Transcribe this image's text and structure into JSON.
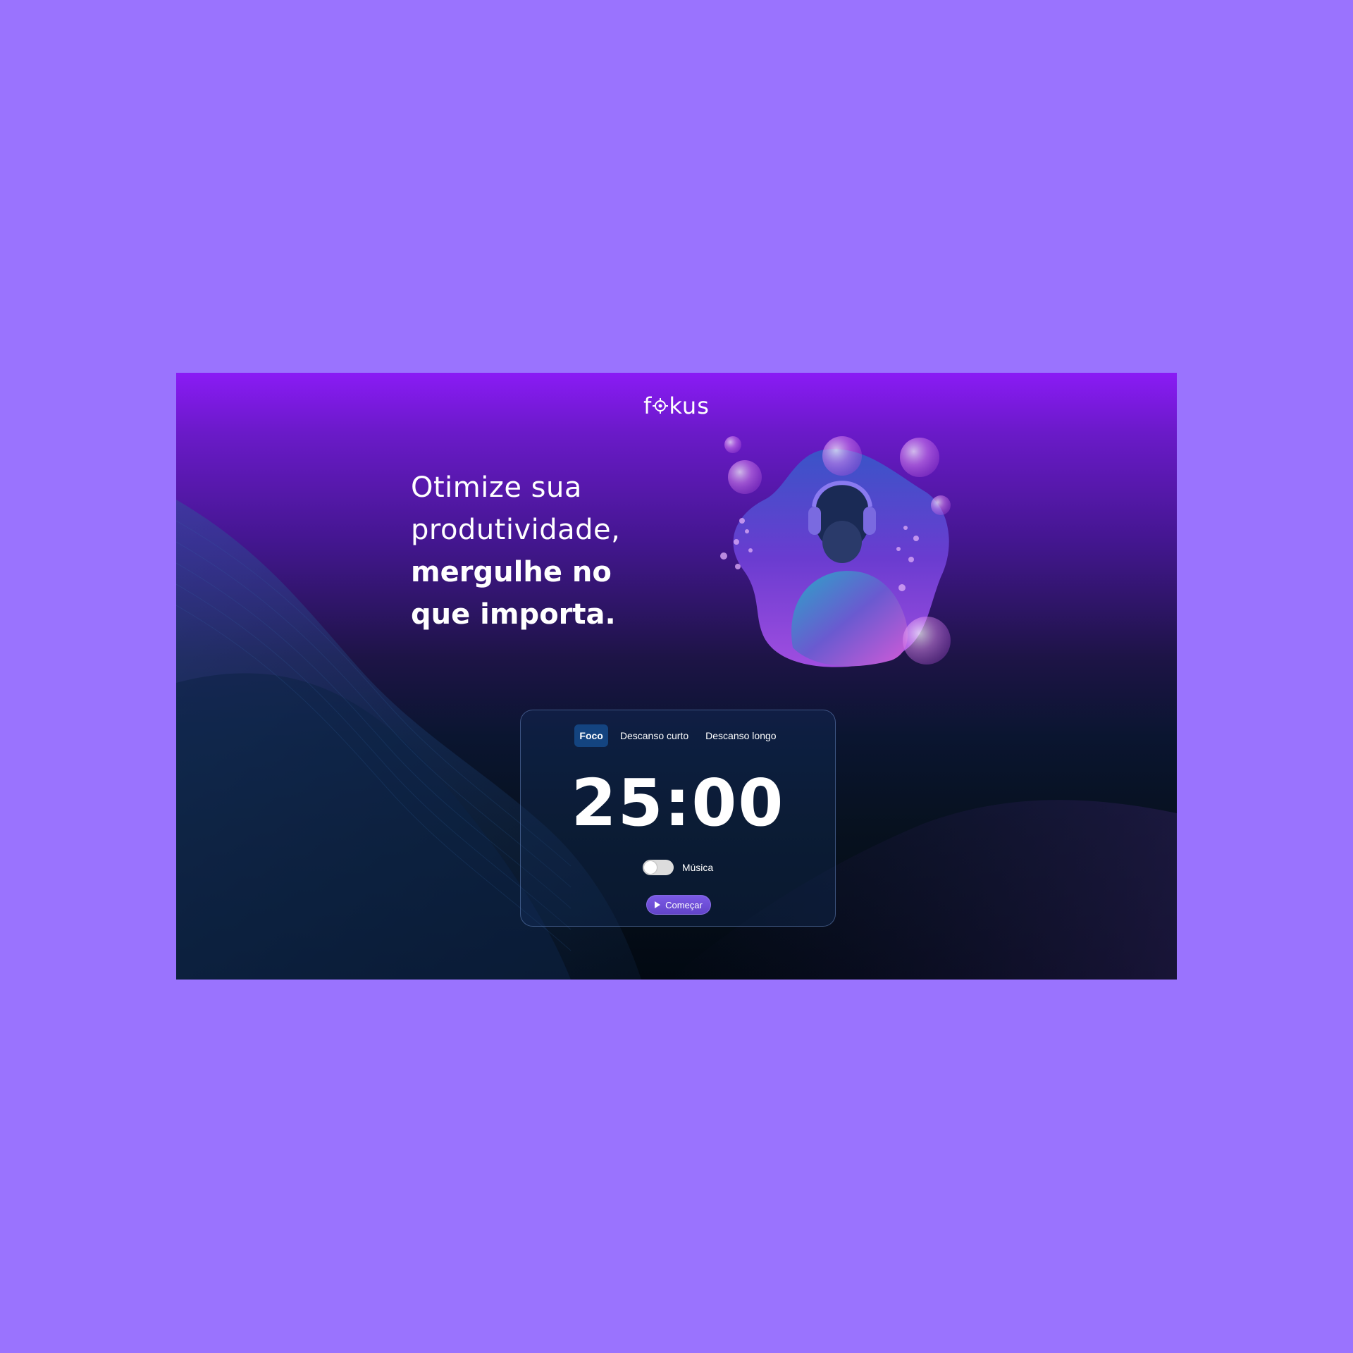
{
  "app": {
    "logo_prefix": "f",
    "logo_suffix": "kus"
  },
  "hero": {
    "line1": "Otimize sua",
    "line2": "produtividade,",
    "line3": "mergulhe no",
    "line4": "que importa."
  },
  "timer": {
    "tabs": [
      {
        "label": "Foco",
        "active": true
      },
      {
        "label": "Descanso curto",
        "active": false
      },
      {
        "label": "Descanso longo",
        "active": false
      }
    ],
    "time": "25:00",
    "music_label": "Música",
    "music_enabled": false,
    "start_label": "Começar"
  },
  "colors": {
    "page_background": "#9a73fe",
    "active_tab": "#144480",
    "start_button": "#6b4fd8",
    "accent_purple": "#8a1bf5"
  },
  "icons": {
    "logo_mark": "target-icon",
    "start": "play-icon",
    "illustration": "diver-with-headphones-illustration"
  }
}
